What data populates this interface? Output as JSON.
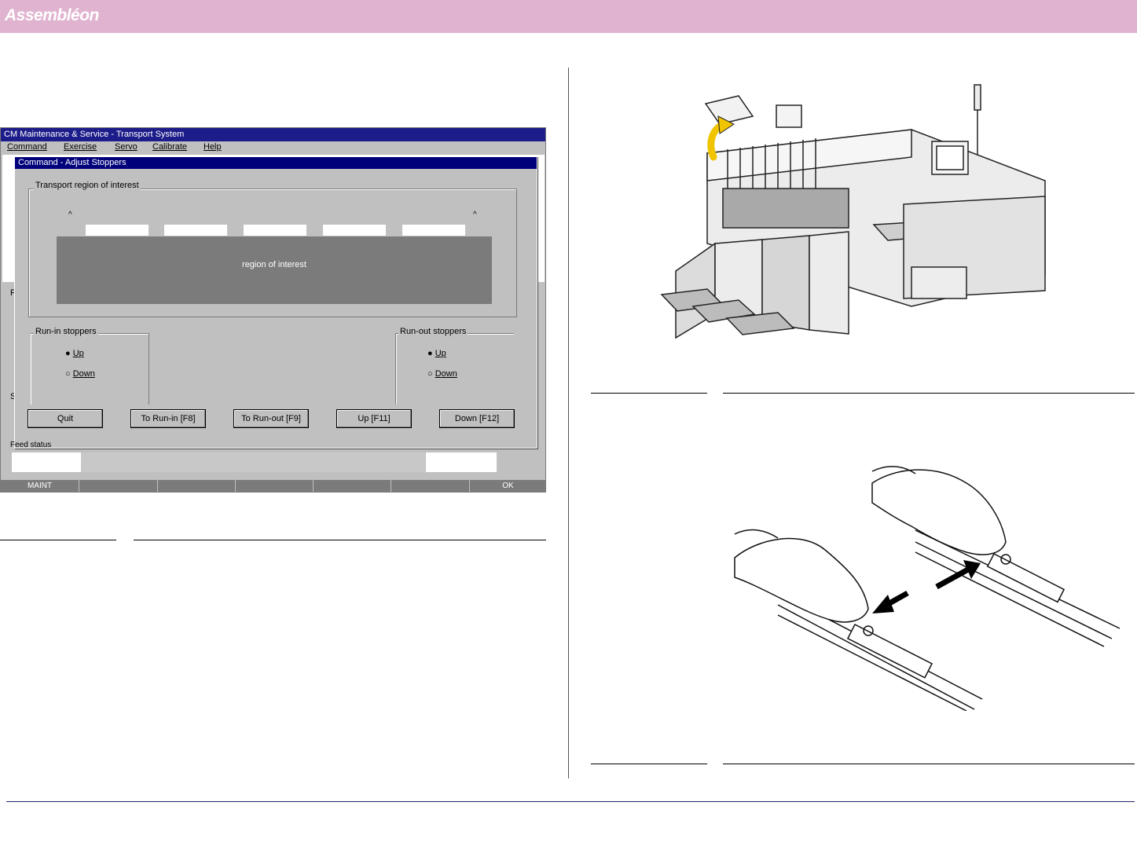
{
  "header": {
    "brand": "Assembléon"
  },
  "screenshot": {
    "window_title": "CM Maintenance & Service - Transport System",
    "menu": [
      "Command",
      "Exercise",
      "Servo",
      "Calibrate",
      "Help"
    ],
    "dialog": {
      "title": "Command - Adjust Stoppers",
      "group_transport": "Transport region of interest",
      "roi_label": "region of interest",
      "caret": "^",
      "group_run_in": "Run-in stoppers",
      "group_run_out": "Run-out stoppers",
      "radio_up": "Up",
      "radio_down": "Down"
    },
    "buttons": {
      "quit": "Quit",
      "to_run_in": "To Run-in [F8]",
      "to_run_out": "To Run-out [F9]",
      "up": "Up [F11]",
      "down": "Down [F12]"
    },
    "bg_letters": [
      "F",
      "S"
    ],
    "status_label": "Feed status",
    "fkeys": [
      "MAINT",
      "",
      "",
      "",
      "",
      "",
      "OK"
    ]
  }
}
